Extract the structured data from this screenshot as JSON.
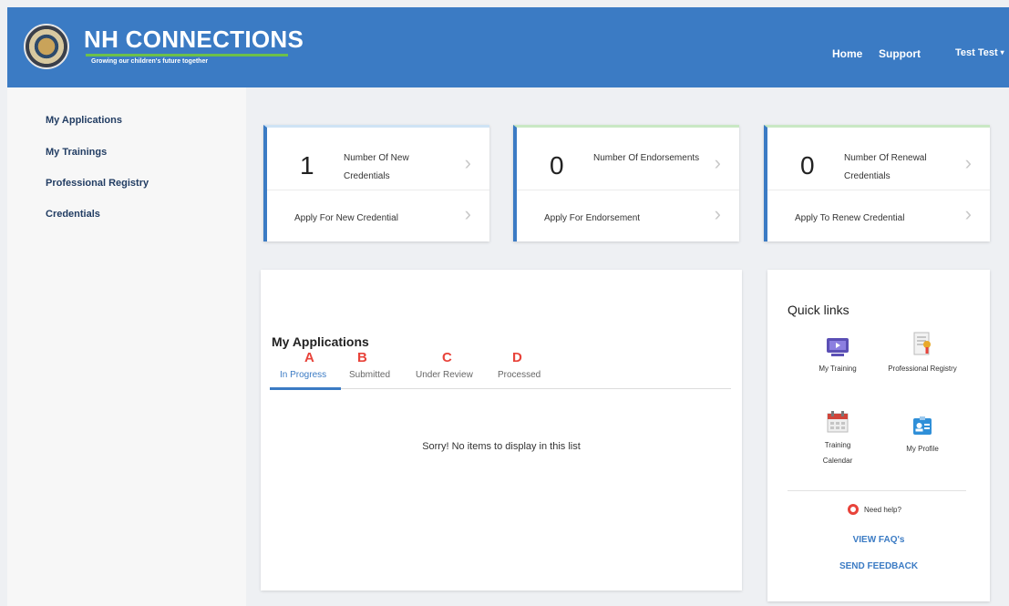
{
  "header": {
    "logo_title": "NH CONNECTIONS",
    "logo_tagline": "Growing our children's future together",
    "nav": {
      "home": "Home",
      "support": "Support"
    },
    "user_name": "Test Test",
    "caret": "▾",
    "colors": {
      "bar": "#3b7bc4",
      "underline": "#6cc04a"
    }
  },
  "sidebar": {
    "items": [
      {
        "label": "My Applications"
      },
      {
        "label": "My Trainings"
      },
      {
        "label": "Professional Registry"
      },
      {
        "label": "Credentials"
      }
    ]
  },
  "cards": [
    {
      "count": "1",
      "label": "Number Of New Credentials",
      "action": "Apply For New Credential",
      "chevron": "›"
    },
    {
      "count": "0",
      "label": "Number Of Endorsements",
      "action": "Apply For Endorsement",
      "chevron": "›"
    },
    {
      "count": "0",
      "label": "Number Of Renewal Credentials",
      "action": "Apply To Renew Credential",
      "chevron": "›"
    }
  ],
  "applications": {
    "title": "My Applications",
    "tabs": [
      {
        "letter": "A",
        "label": "In Progress",
        "active": true
      },
      {
        "letter": "B",
        "label": "Submitted",
        "active": false
      },
      {
        "letter": "C",
        "label": "Under Review",
        "active": false
      },
      {
        "letter": "D",
        "label": "Processed",
        "active": false
      }
    ],
    "empty_message": "Sorry! No items to display in this list"
  },
  "quick_links": {
    "title": "Quick links",
    "items": [
      {
        "label": "My Training",
        "icon": "video-player-icon"
      },
      {
        "label": "Professional Registry",
        "icon": "certificate-icon"
      },
      {
        "label": "Training Calendar",
        "icon": "calendar-icon"
      },
      {
        "label": "My Profile",
        "icon": "profile-card-icon"
      }
    ],
    "help_text": "Need help?",
    "faq_link": "VIEW FAQ's",
    "feedback_link": "SEND FEEDBACK"
  }
}
